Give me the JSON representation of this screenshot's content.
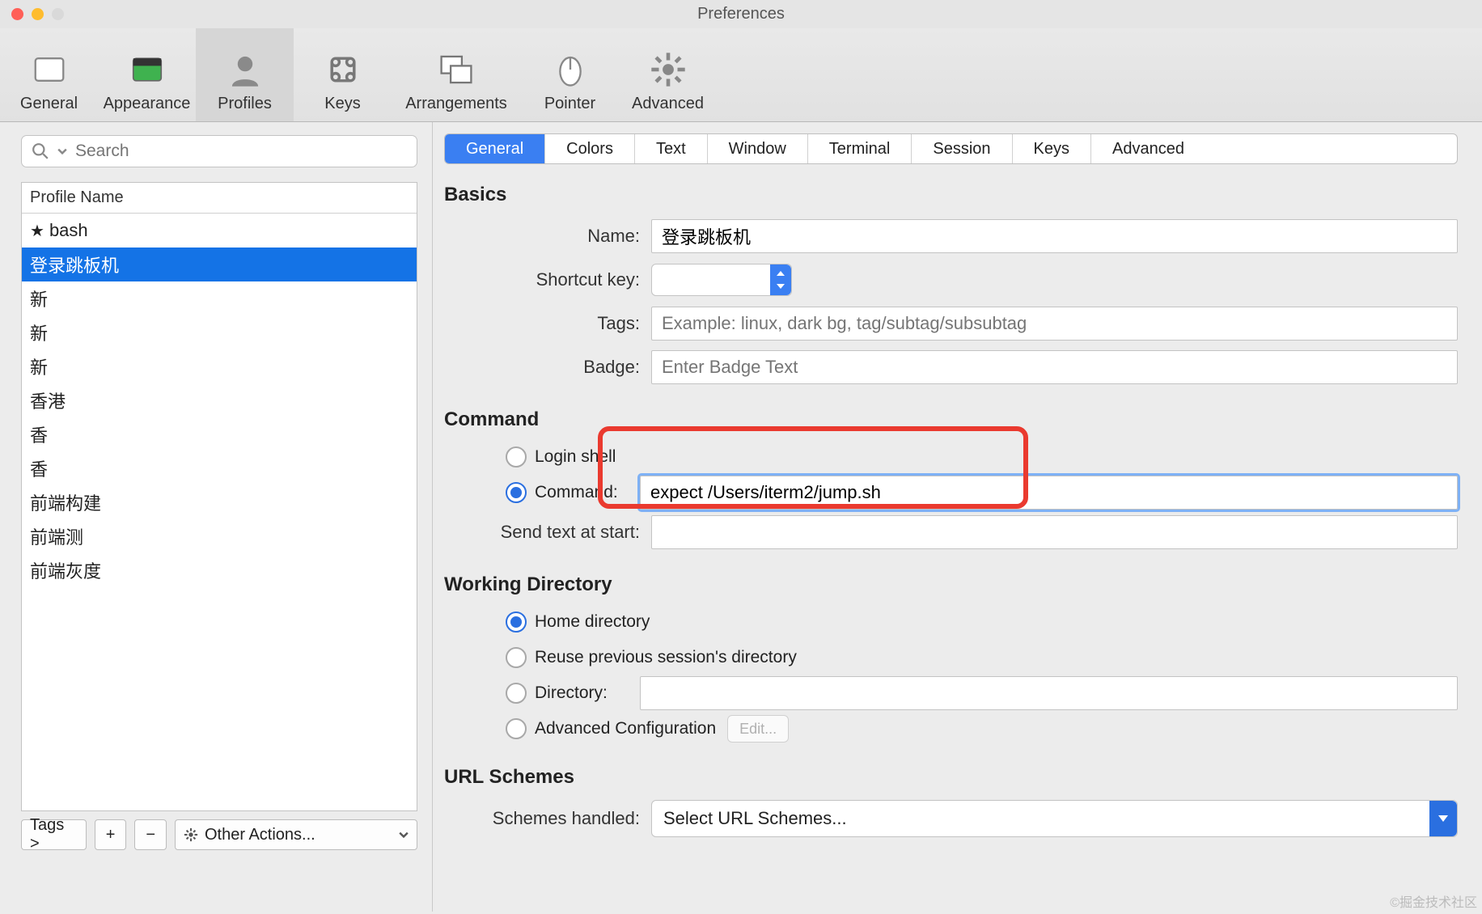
{
  "window_title": "Preferences",
  "toolbar": [
    {
      "id": "general",
      "label": "General"
    },
    {
      "id": "appearance",
      "label": "Appearance"
    },
    {
      "id": "profiles",
      "label": "Profiles"
    },
    {
      "id": "keys",
      "label": "Keys"
    },
    {
      "id": "arrangements",
      "label": "Arrangements"
    },
    {
      "id": "pointer",
      "label": "Pointer"
    },
    {
      "id": "advanced",
      "label": "Advanced"
    }
  ],
  "toolbar_active": "profiles",
  "left": {
    "search_placeholder": "Search",
    "header": "Profile Name",
    "tags_button": "Tags >",
    "other_actions": "Other Actions...",
    "profiles": [
      {
        "name": "bash",
        "starred": true,
        "selected": false
      },
      {
        "name": "登录跳板机",
        "starred": false,
        "selected": true
      },
      {
        "name": "新",
        "starred": false,
        "selected": false
      },
      {
        "name": "新",
        "starred": false,
        "selected": false
      },
      {
        "name": "新",
        "starred": false,
        "selected": false
      },
      {
        "name": "香港",
        "starred": false,
        "selected": false
      },
      {
        "name": "香",
        "starred": false,
        "selected": false
      },
      {
        "name": "香",
        "starred": false,
        "selected": false
      },
      {
        "name": "前端构建",
        "starred": false,
        "selected": false
      },
      {
        "name": "前端测",
        "starred": false,
        "selected": false
      },
      {
        "name": "前端灰度",
        "starred": false,
        "selected": false
      }
    ]
  },
  "tabs": [
    "General",
    "Colors",
    "Text",
    "Window",
    "Terminal",
    "Session",
    "Keys",
    "Advanced"
  ],
  "tab_active": "General",
  "basics": {
    "heading": "Basics",
    "name_label": "Name:",
    "name_value": "登录跳板机",
    "shortcut_label": "Shortcut key:",
    "tags_label": "Tags:",
    "tags_placeholder": "Example: linux, dark bg, tag/subtag/subsubtag",
    "badge_label": "Badge:",
    "badge_placeholder": "Enter Badge Text"
  },
  "command": {
    "heading": "Command",
    "login_shell": "Login shell",
    "command_label": "Command:",
    "command_value": "expect /Users/iterm2/jump.sh",
    "send_text_label": "Send text at start:"
  },
  "workdir": {
    "heading": "Working Directory",
    "home": "Home directory",
    "reuse": "Reuse previous session's directory",
    "dir_label": "Directory:",
    "adv": "Advanced Configuration",
    "edit": "Edit..."
  },
  "url": {
    "heading": "URL Schemes",
    "label": "Schemes handled:",
    "select": "Select URL Schemes..."
  },
  "watermark": "©掘金技术社区"
}
